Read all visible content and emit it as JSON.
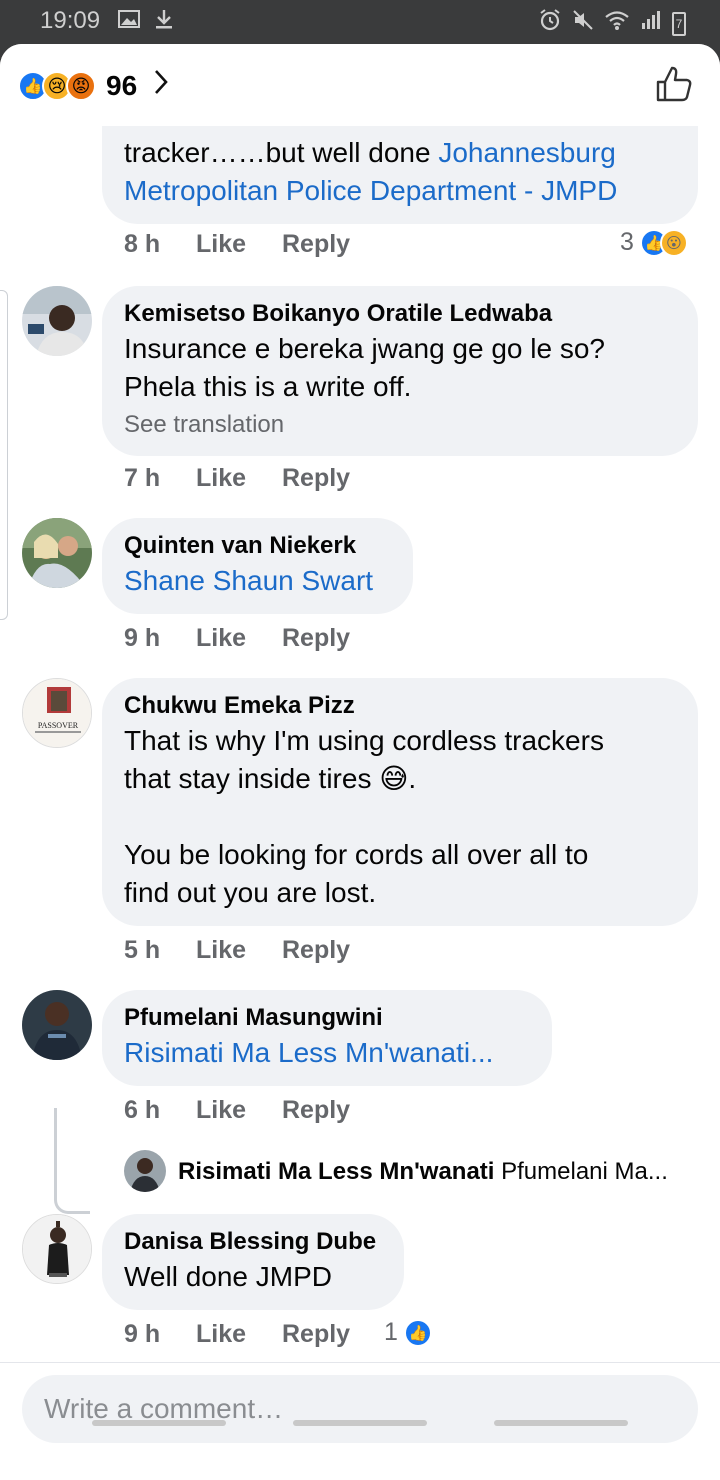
{
  "status_bar": {
    "time": "19:09",
    "battery": "7"
  },
  "header": {
    "reaction_count": "96",
    "reaction_icons": [
      "like",
      "sad",
      "angry"
    ]
  },
  "comments": [
    {
      "id": "c1",
      "partial": true,
      "text": "tracker……but well done ",
      "mention": "Johannesburg Metropolitan Police Department - JMPD",
      "time": "8 h",
      "like": "Like",
      "reply": "Reply",
      "reactions": "3",
      "reaction_icons": [
        "like",
        "wow"
      ]
    },
    {
      "id": "c2",
      "author": "Kemisetso Boikanyo Oratile Ledwaba",
      "text_lines": [
        "Insurance e bereka jwang ge go le so?",
        "Phela this is a write off."
      ],
      "see_translation": "See translation",
      "time": "7 h",
      "like": "Like",
      "reply": "Reply"
    },
    {
      "id": "c3",
      "author": "Quinten van Niekerk",
      "mention": "Shane Shaun Swart",
      "time": "9 h",
      "like": "Like",
      "reply": "Reply"
    },
    {
      "id": "c4",
      "author": "Chukwu Emeka Pizz",
      "text_lines": [
        "That is why I'm using cordless trackers",
        "that stay inside tires 😅.",
        "",
        "You be looking for cords all over all to",
        "find out you are lost."
      ],
      "avatar_caption": "PASSOVER",
      "time": "5 h",
      "like": "Like",
      "reply": "Reply"
    },
    {
      "id": "c5",
      "author": "Pfumelani Masungwini",
      "mention": "Risimati Ma Less Mn'wanati...",
      "time": "6 h",
      "like": "Like",
      "reply": "Reply",
      "reply_preview": {
        "name": "Risimati Ma Less Mn'wanati",
        "text": " Pfumelani Ma..."
      }
    },
    {
      "id": "c6",
      "author": "Danisa Blessing Dube",
      "text": "Well done JMPD",
      "time": "9 h",
      "like": "Like",
      "reply": "Reply",
      "reactions": "1",
      "reaction_icons": [
        "like"
      ]
    }
  ],
  "composer": {
    "placeholder": "Write a comment…"
  },
  "colors": {
    "link": "#1b6bc9",
    "bubble": "#f0f2f5",
    "meta": "#65676b",
    "like_blue": "#1877f2"
  }
}
